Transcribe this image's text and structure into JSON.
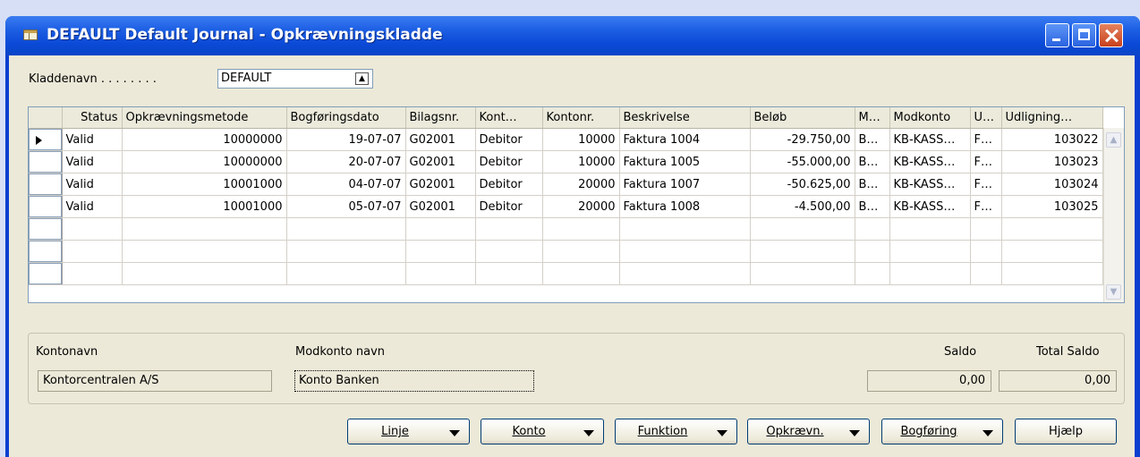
{
  "window": {
    "title": "DEFAULT Default Journal - Opkrævningskladde",
    "icon": "journal-table-icon"
  },
  "batch": {
    "label": "Kladdenavn . . . . . . . .",
    "value": "DEFAULT",
    "lookup_icon": "lookup-arrow-up-icon"
  },
  "grid": {
    "columns": [
      "Status",
      "Opkrævningsmetode",
      "Bogføringsdato",
      "Bilagsnr.",
      "Kont…",
      "Kontonr.",
      "Beskrivelse",
      "Beløb",
      "M…",
      "Modkonto",
      "U…",
      "Udligning…"
    ],
    "rows": [
      [
        "Valid",
        "10000000",
        "19-07-07",
        "G02001",
        "Debitor",
        "10000",
        "Faktura 1004",
        "-29.750,00",
        "B…",
        "KB-KASS…",
        "F…",
        "103022"
      ],
      [
        "Valid",
        "10000000",
        "20-07-07",
        "G02001",
        "Debitor",
        "10000",
        "Faktura 1005",
        "-55.000,00",
        "B…",
        "KB-KASS…",
        "F…",
        "103023"
      ],
      [
        "Valid",
        "10001000",
        "04-07-07",
        "G02001",
        "Debitor",
        "20000",
        "Faktura 1007",
        "-50.625,00",
        "B…",
        "KB-KASS…",
        "F…",
        "103024"
      ],
      [
        "Valid",
        "10001000",
        "05-07-07",
        "G02001",
        "Debitor",
        "20000",
        "Faktura 1008",
        "-4.500,00",
        "B…",
        "KB-KASS…",
        "F…",
        "103025"
      ]
    ]
  },
  "info": {
    "account_name_label": "Kontonavn",
    "account_name": "Kontorcentralen A/S",
    "bal_account_name_label": "Modkonto navn",
    "bal_account_name": "Konto Banken",
    "balance_label": "Saldo",
    "balance": "0,00",
    "total_balance_label": "Total Saldo",
    "total_balance": "0,00"
  },
  "buttons": {
    "line": "Linje",
    "account": "Konto",
    "function": "Funktion",
    "collection": "Opkrævn.",
    "posting": "Bogføring",
    "help": "Hjælp"
  }
}
